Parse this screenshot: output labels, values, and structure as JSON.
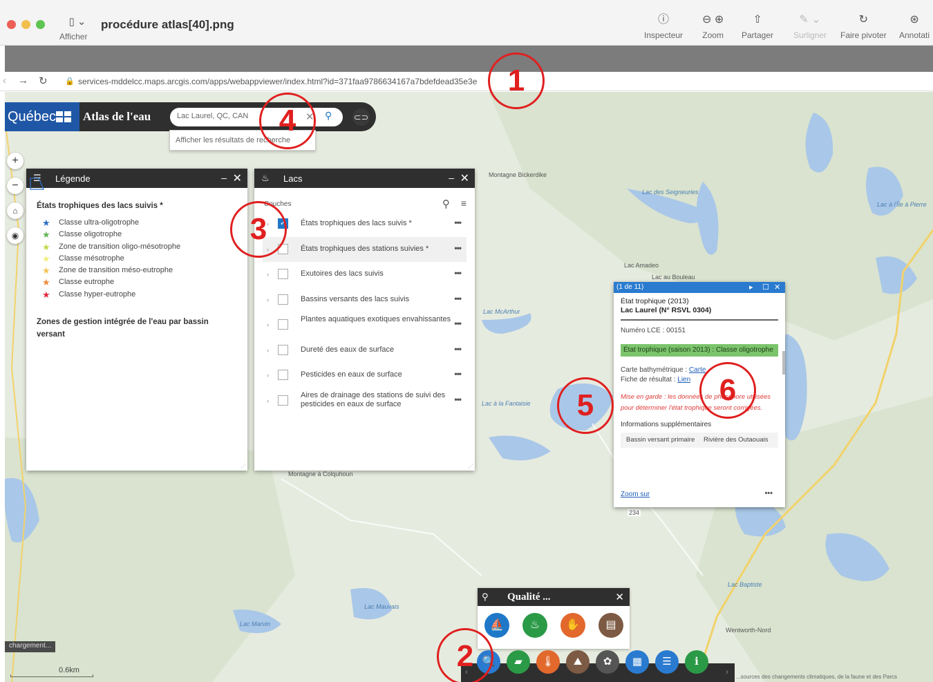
{
  "window": {
    "sidebar_label": "Afficher",
    "title": "procédure atlas[40].png",
    "toolbar": [
      {
        "label": "Inspecteur",
        "icon": "info-icon",
        "glyph": "ⓘ"
      },
      {
        "label": "Zoom",
        "icon": "zoom-icon",
        "glyph": "⊖ ⊕"
      },
      {
        "label": "Partager",
        "icon": "share-icon",
        "glyph": "⇧"
      },
      {
        "label": "Surligner",
        "icon": "highlight-icon",
        "glyph": "✎ ⌄"
      },
      {
        "label": "Faire pivoter",
        "icon": "rotate-icon",
        "glyph": "↻"
      },
      {
        "label": "Annotati",
        "icon": "annotate-icon",
        "glyph": "⊛"
      }
    ]
  },
  "browser": {
    "url": "services-mddelcc.maps.arcgis.com/apps/webappviewer/index.html?id=371faa9786634167a7bdefdead35e3e"
  },
  "app": {
    "logo": "Québec",
    "title": "Atlas de l'eau",
    "search_value": "Lac Laurel, QC, CAN",
    "search_results_link": "Afficher les résultats de recherche"
  },
  "legend_panel": {
    "title": "Légende",
    "heading": "États trophiques des lacs suivis *",
    "items": [
      {
        "label": "Classe ultra-oligotrophe",
        "color": "#2e6fc7"
      },
      {
        "label": "Classe oligotrophe",
        "color": "#62b558"
      },
      {
        "label": "Zone de transition oligo-mésotrophe",
        "color": "#c4d84a"
      },
      {
        "label": "Classe mésotrophe",
        "color": "#f3ee7a"
      },
      {
        "label": "Zone de transition méso-eutrophe",
        "color": "#f3c24f"
      },
      {
        "label": "Classe eutrophe",
        "color": "#f08a3b"
      },
      {
        "label": "Classe hyper-eutrophe",
        "color": "#e2283c"
      }
    ],
    "heading2": "Zones de gestion intégrée de l'eau par bassin versant"
  },
  "lacs_panel": {
    "title": "Lacs",
    "couches_label": "Couches",
    "layers": [
      {
        "label": "États trophiques des lacs suivis *",
        "checked": true
      },
      {
        "label": "États trophiques des stations suivies *",
        "checked": false
      },
      {
        "label": "Exutoires des lacs suivis",
        "checked": false
      },
      {
        "label": "Bassins versants des lacs suivis",
        "checked": false
      },
      {
        "label": "Plantes aquatiques exotiques envahissantes",
        "checked": false
      },
      {
        "label": "Dureté des eaux de surface",
        "checked": false
      },
      {
        "label": "Pesticides en eaux de surface",
        "checked": false
      },
      {
        "label": "Aires de drainage des stations de suivi des pesticides en eaux de surface",
        "checked": false
      }
    ]
  },
  "popup": {
    "pager": "(1 de 11)",
    "title_line1": "État trophique (2013)",
    "title_line2": "Lac Laurel (N° RSVL 0304)",
    "numero": "Numéro LCE : 00151",
    "etat": "État trophique (saison 2013) : Classe oligotrophe",
    "carte_label": "Carte bathymétrique :",
    "carte_link": "Carte",
    "fiche_label": "Fiche de résultat :",
    "fiche_link": "Lien",
    "warning": "Mise en garde : les données de phosphore utilisées pour déterminer l'état trophique seront corrigées.",
    "section": "Informations supplémentaires",
    "table_key": "Bassin versant primaire",
    "table_value": "Rivière des Outaouais",
    "zoom_link": "Zoom sur"
  },
  "qualite_widget": {
    "title": "Qualité ...",
    "icons": [
      {
        "name": "boat-icon",
        "color": "#1f77c8",
        "glyph": "⛵"
      },
      {
        "name": "water-quality-icon",
        "color": "#2b9a47",
        "glyph": "♨"
      },
      {
        "name": "hand-water-icon",
        "color": "#e2682c",
        "glyph": "✋"
      },
      {
        "name": "document-icon",
        "color": "#7d5a43",
        "glyph": "▤"
      }
    ]
  },
  "dock": {
    "icons": [
      {
        "name": "search-layer-icon",
        "color": "#2a7bd0",
        "glyph": "🔍"
      },
      {
        "name": "basemap-icon",
        "color": "#2b9a47",
        "glyph": "▰"
      },
      {
        "name": "thermometer-icon",
        "color": "#e2682c",
        "glyph": "🌡"
      },
      {
        "name": "lake-icon",
        "color": "#7d5a43",
        "glyph": "⛰"
      },
      {
        "name": "plant-icon",
        "color": "#555555",
        "glyph": "✿"
      },
      {
        "name": "grid-icon",
        "color": "#2a7bd0",
        "glyph": "▦"
      },
      {
        "name": "list-icon",
        "color": "#2a7bd0",
        "glyph": "☰"
      },
      {
        "name": "about-icon",
        "color": "#2b9a47",
        "glyph": "ℹ"
      }
    ]
  },
  "map": {
    "loading": "chargement...",
    "scale": "0.6km",
    "attribution": "...sources des changements climatiques, de la faune et des Parcs",
    "labels": [
      {
        "text": "Montagne Bickerdike"
      },
      {
        "text": "Lac des Seigneuries"
      },
      {
        "text": "Lac à l'Île à Pierre"
      },
      {
        "text": "Lac Amadeo"
      },
      {
        "text": "Lac au Bouleau"
      },
      {
        "text": "Lac McArthur"
      },
      {
        "text": "Lac à la Fantaisie"
      },
      {
        "text": "Lac Baptiste"
      },
      {
        "text": "Lac Marvin"
      },
      {
        "text": "Wentworth-Nord"
      },
      {
        "text": "Montagne à Colquhoun"
      },
      {
        "text": "Lac Mauvais"
      },
      {
        "text": "234"
      }
    ]
  },
  "annotations": [
    "1",
    "2",
    "3",
    "4",
    "5",
    "6"
  ]
}
